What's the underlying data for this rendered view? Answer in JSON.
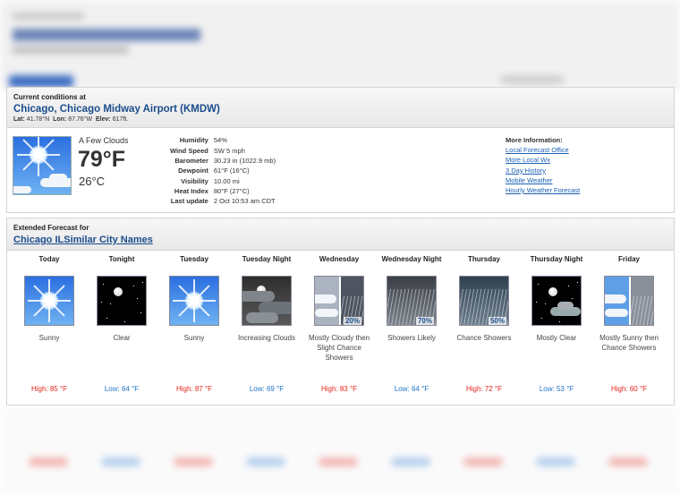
{
  "current": {
    "label": "Current conditions at",
    "station": "Chicago, Chicago Midway Airport (KMDW)",
    "lat_label": "Lat:",
    "lat": "41.78°N",
    "lon_label": "Lon:",
    "lon": "87.76°W",
    "elev_label": "Elev:",
    "elev": "617ft.",
    "icon": "few-clouds-icon",
    "condition": "A Few Clouds",
    "temp_f": "79°F",
    "temp_c": "26°C",
    "details": [
      {
        "key": "Humidity",
        "value": "54%"
      },
      {
        "key": "Wind Speed",
        "value": "SW 5 mph"
      },
      {
        "key": "Barometer",
        "value": "30.23 in (1022.9 mb)"
      },
      {
        "key": "Dewpoint",
        "value": "61°F (16°C)"
      },
      {
        "key": "Visibility",
        "value": "10.00 mi"
      },
      {
        "key": "Heat Index",
        "value": "80°F (27°C)"
      },
      {
        "key": "Last update",
        "value": "2 Oct 10:53 am CDT"
      }
    ],
    "more_title": "More Information:",
    "more_links": [
      "Local Forecast Office",
      "More Local Wx",
      "3 Day History",
      "Mobile Weather",
      "Hourly Weather Forecast"
    ]
  },
  "extended": {
    "label": "Extended Forecast for",
    "location": "Chicago IL",
    "similar": "Similar City Names",
    "periods": [
      {
        "name": "Today",
        "short": "Sunny",
        "temp": "High: 85 °F",
        "kind": "hi",
        "icon": "sunny-icon",
        "pop": ""
      },
      {
        "name": "Tonight",
        "short": "Clear",
        "temp": "Low: 64 °F",
        "kind": "lo",
        "icon": "clear-night-icon",
        "pop": ""
      },
      {
        "name": "Tuesday",
        "short": "Sunny",
        "temp": "High: 87 °F",
        "kind": "hi",
        "icon": "sunny-icon",
        "pop": ""
      },
      {
        "name": "Tuesday Night",
        "short": "Increasing Clouds",
        "temp": "Low: 69 °F",
        "kind": "lo",
        "icon": "increasing-clouds-night-icon",
        "pop": ""
      },
      {
        "name": "Wednesday",
        "short": "Mostly Cloudy then Slight Chance Showers",
        "temp": "High: 83 °F",
        "kind": "hi",
        "icon": "cloudy-then-showers-icon",
        "pop": "20%"
      },
      {
        "name": "Wednesday Night",
        "short": "Showers Likely",
        "temp": "Low: 64 °F",
        "kind": "lo",
        "icon": "showers-icon",
        "pop": "70%"
      },
      {
        "name": "Thursday",
        "short": "Chance Showers",
        "temp": "High: 72 °F",
        "kind": "hi",
        "icon": "chance-showers-icon",
        "pop": "50%"
      },
      {
        "name": "Thursday Night",
        "short": "Mostly Clear",
        "temp": "Low: 53 °F",
        "kind": "lo",
        "icon": "mostly-clear-night-icon",
        "pop": ""
      },
      {
        "name": "Friday",
        "short": "Mostly Sunny then Chance Showers",
        "temp": "High: 60 °F",
        "kind": "hi",
        "icon": "sunny-then-showers-icon",
        "pop": ""
      }
    ]
  },
  "colors": {
    "link": "#1b5fb5",
    "station": "#1b4c8c",
    "high": "#e5231b",
    "low": "#1f73c7"
  }
}
